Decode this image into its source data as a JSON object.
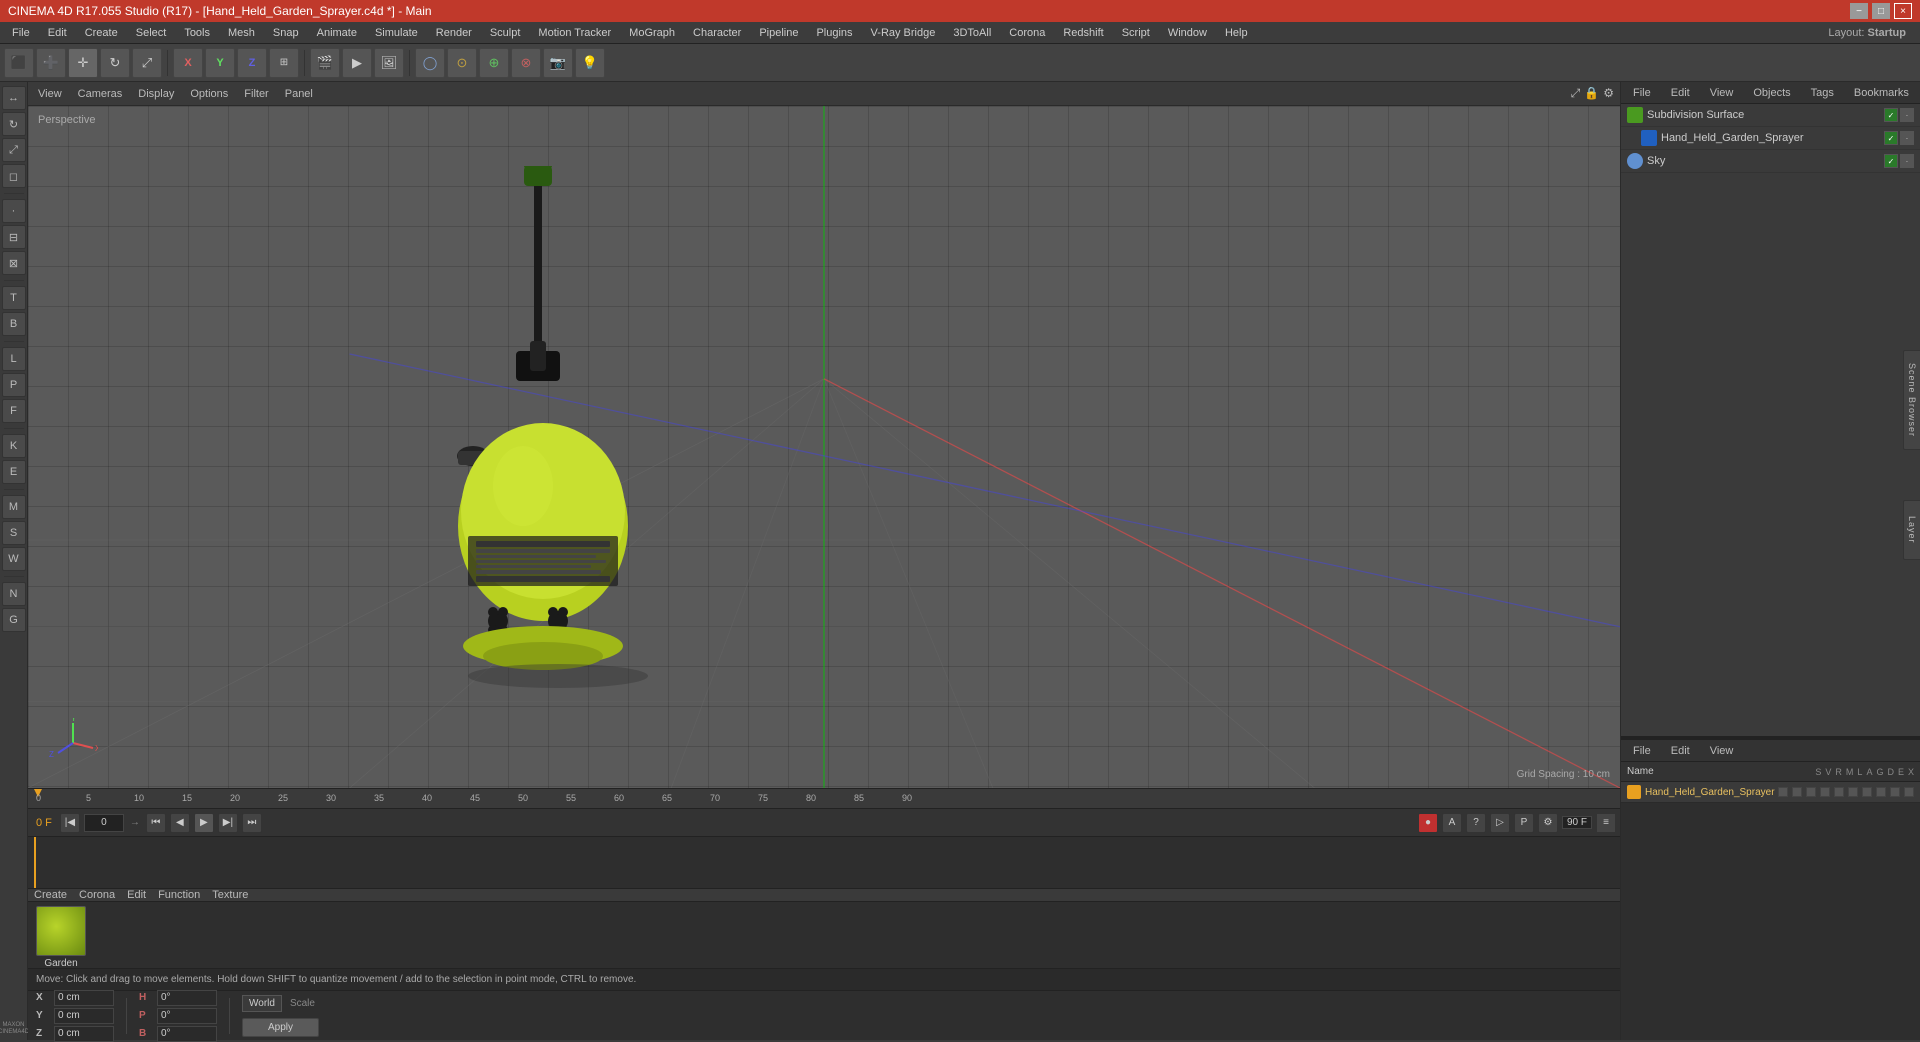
{
  "titleBar": {
    "title": "CINEMA 4D R17.055 Studio (R17) - [Hand_Held_Garden_Sprayer.c4d *] - Main",
    "minimize": "−",
    "restore": "□",
    "close": "×"
  },
  "menuBar": {
    "items": [
      "File",
      "Edit",
      "Create",
      "Select",
      "Tools",
      "Mesh",
      "Snap",
      "Animate",
      "Simulate",
      "Render",
      "Sculpt",
      "Motion Tracker",
      "MoGraph",
      "Character",
      "Pipeline",
      "Plugins",
      "V-Ray Bridge",
      "3DToAll",
      "Corona",
      "Redshift",
      "Script",
      "Window",
      "Help"
    ],
    "layout": "Layout:",
    "layoutValue": "Startup"
  },
  "viewport": {
    "label": "Perspective",
    "gridSpacing": "Grid Spacing : 10 cm"
  },
  "timeline": {
    "startFrame": "0 F",
    "endFrame": "90 F",
    "currentFrame": "0 F",
    "currentFrameInput": "0",
    "marks": [
      "0",
      "5",
      "10",
      "15",
      "20",
      "25",
      "30",
      "35",
      "40",
      "45",
      "50",
      "55",
      "60",
      "65",
      "70",
      "75",
      "80",
      "85",
      "90"
    ]
  },
  "materialEditor": {
    "tabs": [
      "Create",
      "Corona",
      "Edit",
      "Function",
      "Texture"
    ],
    "material": {
      "name": "Garden"
    }
  },
  "statusBar": {
    "text": "Move: Click and drag to move elements. Hold down SHIFT to quantize movement / add to the selection in point mode, CTRL to remove."
  },
  "rightPanel": {
    "header": {
      "tabs": [
        "File",
        "Edit",
        "View",
        "Objects",
        "Tags",
        "Bookmarks"
      ]
    },
    "objects": [
      {
        "name": "Subdivision Surface",
        "icon": "green",
        "checked": true
      },
      {
        "name": "Hand_Held_Garden_Sprayer",
        "icon": "blue",
        "checked": true
      },
      {
        "name": "Sky",
        "icon": "sky",
        "checked": true
      }
    ],
    "bottomHeader": {
      "tabs": [
        "File",
        "Edit",
        "View"
      ]
    },
    "attributes": {
      "nameLabel": "Name",
      "nameValue": "Hand_Held_Garden_Sprayer",
      "columns": [
        "S",
        "V",
        "R",
        "M",
        "L",
        "A",
        "G",
        "D",
        "E",
        "X"
      ]
    }
  },
  "coordBar": {
    "position": {
      "x": {
        "label": "X",
        "value": "0 cm"
      },
      "y": {
        "label": "Y",
        "value": "0 cm"
      },
      "z": {
        "label": "Z",
        "value": "0 cm"
      }
    },
    "rotation": {
      "h": {
        "label": "H",
        "value": "0°"
      },
      "p": {
        "label": "P",
        "value": "0°"
      },
      "b": {
        "label": "B",
        "value": "0°"
      }
    },
    "scaleLabel": "Scale",
    "worldLabel": "World",
    "applyLabel": "Apply"
  },
  "viewportMenu": {
    "items": [
      "View",
      "Cameras",
      "Display",
      "Options",
      "Filter",
      "Panel"
    ]
  }
}
